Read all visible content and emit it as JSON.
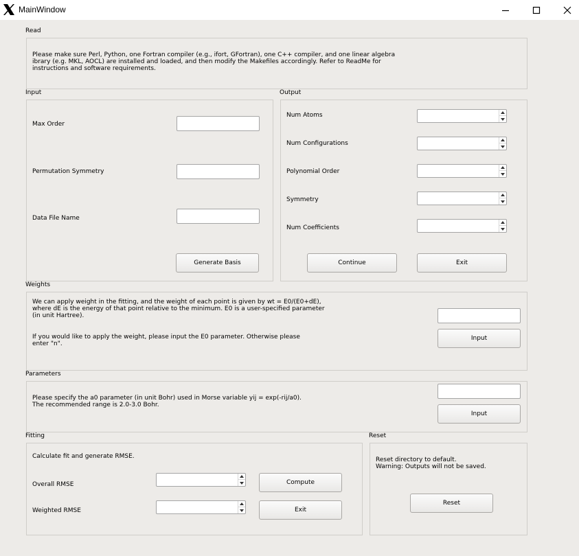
{
  "window": {
    "title": "MainWindow"
  },
  "read": {
    "group_label": "Read",
    "text": "Please make sure Perl, Python, one Fortran compiler (e.g., ifort, GFortran), one C++ compiler, and one linear algebra\nibrary (e.g. MKL, AOCL) are installed and loaded, and then modify the Makefiles accordingly. Refer to ReadMe for\ninstructions and software requirements."
  },
  "input": {
    "group_label": "Input",
    "max_order_label": "Max Order",
    "max_order_value": "",
    "perm_sym_label": "Permutation Symmetry",
    "perm_sym_value": "",
    "data_file_label": "Data File Name",
    "data_file_value": "",
    "generate_button": "Generate Basis"
  },
  "output": {
    "group_label": "Output",
    "num_atoms_label": "Num Atoms",
    "num_configs_label": "Num Configurations",
    "poly_order_label": "Polynomial Order",
    "symmetry_label": "Symmetry",
    "num_coeffs_label": "Num Coefficients",
    "continue_button": "Continue",
    "exit_button": "Exit"
  },
  "weights": {
    "group_label": "Weights",
    "text1": "We can apply weight in the fitting, and the weight of each point is given by wt = E0/(E0+dE),\nwhere dE is the energy of that point relative to the minimum. E0 is a user-specified parameter\n(in unit Hartree).",
    "text2": "If you would like to apply the weight, please input the E0 parameter. Otherwise please\nenter \"n\".",
    "input_value": "",
    "input_button": "Input"
  },
  "parameters": {
    "group_label": "Parameters",
    "text": "Please specify the a0 parameter (in unit Bohr) used in Morse variable yij = exp(-rij/a0).\nThe recommended range is 2.0-3.0 Bohr.",
    "input_value": "",
    "input_button": "Input"
  },
  "fitting": {
    "group_label": "Fitting",
    "text": "Calculate fit and generate RMSE.",
    "overall_rmse_label": "Overall RMSE",
    "weighted_rmse_label": "Weighted RMSE",
    "compute_button": "Compute",
    "exit_button": "Exit"
  },
  "reset": {
    "group_label": "Reset",
    "text": "Reset directory to default.\nWarning: Outputs will not be saved.",
    "reset_button": "Reset"
  },
  "icons": {
    "app": "x-logo-icon",
    "minimize": "minimize-icon",
    "maximize": "maximize-icon",
    "close": "close-icon"
  }
}
